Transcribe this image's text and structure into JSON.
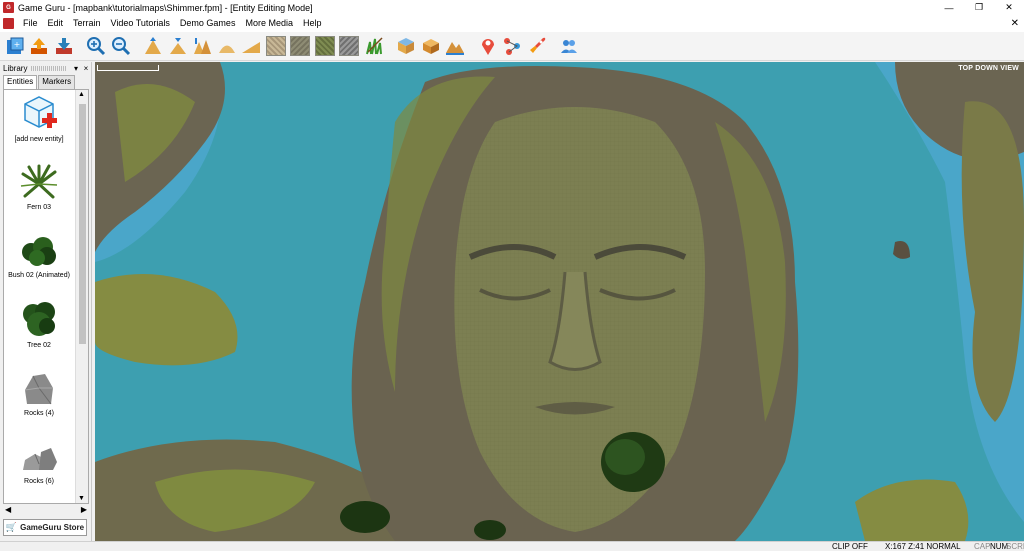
{
  "window": {
    "title": "Game Guru - [mapbank\\tutorialmaps\\Shimmer.fpm] - [Entity Editing Mode]",
    "app_icon": "gameguru-logo-icon",
    "controls": [
      "—",
      "❐",
      "✕"
    ]
  },
  "menu": {
    "items": [
      "File",
      "Edit",
      "Terrain",
      "Video Tutorials",
      "Demo Games",
      "More Media",
      "Help"
    ],
    "close_glyph": "✕"
  },
  "toolbar": {
    "buttons": [
      {
        "name": "new-level-icon"
      },
      {
        "name": "load-level-icon"
      },
      {
        "name": "save-level-icon"
      },
      {
        "name": "zoom-in-icon"
      },
      {
        "name": "zoom-out-icon"
      },
      {
        "name": "raise-terrain-icon"
      },
      {
        "name": "lower-terrain-icon"
      },
      {
        "name": "level-terrain-icon"
      },
      {
        "name": "blend-terrain-icon"
      },
      {
        "name": "ramp-terrain-icon"
      },
      {
        "name": "paint-texture-1-icon"
      },
      {
        "name": "paint-texture-2-icon"
      },
      {
        "name": "paint-texture-3-icon"
      },
      {
        "name": "paint-texture-4-icon"
      },
      {
        "name": "paint-grass-icon"
      },
      {
        "name": "entity-mode-icon"
      },
      {
        "name": "waypoint-mode-icon"
      },
      {
        "name": "markers-mode-icon"
      },
      {
        "name": "place-marker-icon"
      },
      {
        "name": "waypoint-connect-icon"
      },
      {
        "name": "test-game-icon"
      },
      {
        "name": "social-vr-icon"
      }
    ],
    "texture_colors": [
      "#b9a98a",
      "#8a8a72",
      "#7d8a55",
      "#8c8c8c"
    ]
  },
  "library": {
    "title": "Library",
    "tabs": [
      "Entities",
      "Markers"
    ],
    "active_tab": "Entities",
    "items": [
      {
        "label": "[add new entity]",
        "icon": "add-entity-icon"
      },
      {
        "label": "Fern 03",
        "icon": "fern-icon"
      },
      {
        "label": "Bush 02 (Animated)",
        "icon": "bush-icon"
      },
      {
        "label": "Tree 02",
        "icon": "tree-icon"
      },
      {
        "label": "Rocks (4)",
        "icon": "rock-icon"
      },
      {
        "label": "Rocks (6)",
        "icon": "rocks-icon"
      }
    ],
    "store_label": "GameGuru Store"
  },
  "viewport": {
    "view_label": "TOP DOWN VIEW",
    "colors": {
      "water": "#3d9fb0",
      "shallow": "#4aa6c9",
      "grass": "#7f8a40",
      "rock": "#6b6552"
    }
  },
  "statusbar": {
    "clip": "CLIP OFF",
    "coords": "X:167  Z:41 NORMAL",
    "keys_dim": "CAP",
    "keys_num": "NUM",
    "keys_scrl": "SCRL"
  }
}
